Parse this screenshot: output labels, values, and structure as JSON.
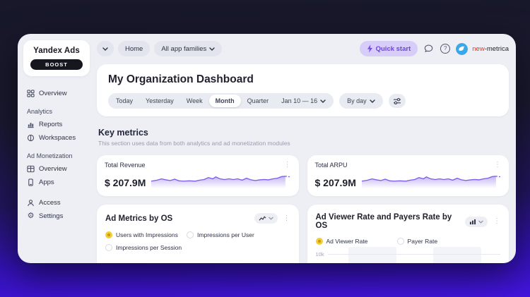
{
  "colors": {
    "accent": "#6f42e8",
    "sparkline": "#7d5ce8",
    "selected_radio": "#f3cd35",
    "avatar_blue": "#3aa7e9",
    "badge_bg": "#16161f",
    "background_bottom": "#4415e0"
  },
  "sidebar": {
    "logo": "Yandex Ads",
    "badge": "BOOST",
    "items": [
      {
        "label": "Overview"
      },
      {
        "label": "Analytics"
      },
      {
        "label": "Reports"
      },
      {
        "label": "Workspaces"
      },
      {
        "label": "Ad Monetization"
      },
      {
        "label": "Overview"
      },
      {
        "label": "Apps"
      },
      {
        "label": "Access"
      },
      {
        "label": "Settings"
      }
    ]
  },
  "topbar": {
    "home_label": "Home",
    "app_families_label": "All app families",
    "quick_start_label": "Quick start",
    "help_icon_glyph": "?",
    "user_name_highlight": "new",
    "user_name_rest": "-metrica"
  },
  "dashboard": {
    "title": "My Organization Dashboard",
    "filters": {
      "tabs": [
        "Today",
        "Yesterday",
        "Week",
        "Month",
        "Quarter"
      ],
      "selected_tab": "Month",
      "date_range": "Jan 10 — 16",
      "granularity": "By day"
    }
  },
  "key_metrics": {
    "heading": "Key metrics",
    "subtitle": "This section uses data from both analytics and ad monetization modules",
    "cards": [
      {
        "label": "Total Revenue",
        "value": "$ 207.9M"
      },
      {
        "label": "Total ARPU",
        "value": "$ 207.9M"
      }
    ]
  },
  "charts": [
    {
      "title": "Ad Metrics by OS",
      "chart_type": "line",
      "legend": [
        {
          "label": "Users with Impressions",
          "selected": true
        },
        {
          "label": "Impressions per User",
          "selected": false
        },
        {
          "label": "Impressions per Session",
          "selected": false
        }
      ]
    },
    {
      "title": "Ad Viewer Rate and Payers Rate by OS",
      "chart_type": "bar",
      "legend": [
        {
          "label": "Ad Viewer Rate",
          "selected": true
        },
        {
          "label": "Payer Rate",
          "selected": false
        }
      ],
      "y_tick": "10k"
    }
  ]
}
